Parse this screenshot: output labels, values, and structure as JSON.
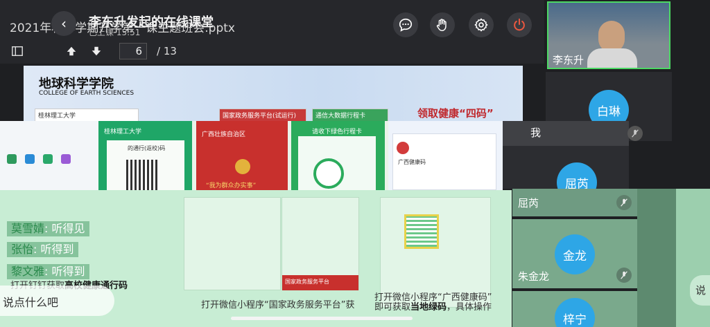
{
  "header": {
    "doc_title": "2021年秋季学期开学第一课主题班会.pptx",
    "class_title": "李东升发起的在线课堂",
    "class_status": "已上课 15:51"
  },
  "controls": [
    "chat-icon",
    "raise-hand-icon",
    "settings-icon",
    "power-icon"
  ],
  "accent_colors": {
    "power": "#e9573f",
    "speaking_border": "#4cd964",
    "avatar": "#2ea6e6"
  },
  "pager": {
    "current": "6",
    "total": "/ 13"
  },
  "slide": {
    "school_cn": "地球科学学院",
    "school_en": "COLLEGE OF EARTH SCIENCES",
    "card1": "桂林理工大学",
    "card2": "国家政务服务平台(试运行)",
    "card3": "通信大数据行程卡",
    "heading": "领取健康“四码”",
    "strip_school": "桂林理工大学",
    "strip_pass": "的通行(返校)码",
    "strip_region": "广西壮族自治区",
    "strip_slogan": "“我为群众办实事”",
    "strip_card": "请收下绿色行程卡",
    "strip_gov": "国家政务服务平台",
    "strip_health": "广西健康码"
  },
  "captions": {
    "c1_prefix": "打开钉钉获取",
    "c1_bold": "高校健康通行码",
    "c2": "打开微信小程序“国家政务服务平台”获",
    "c3_prefix": "打开微信小程序“广西健康码”",
    "c3_line2_prefix": "即可获取",
    "c3_bold": "当地绿码",
    "c3_suffix": "，具体操作"
  },
  "chat": [
    {
      "name": "莫雪婧",
      "text": ": 听得见"
    },
    {
      "name": "张怡",
      "text": ": 听得到"
    },
    {
      "name": "黎文雅",
      "text": ": 听得到"
    }
  ],
  "chat_input_placeholder": "说点什么吧",
  "participants": {
    "host": "李东升",
    "p1_avatar": "白琳",
    "p1_name": "我",
    "p2_avatar": "屈芮",
    "p2_name": "屈芮",
    "p3_avatar": "金龙",
    "p3_name": "朱金龙",
    "p4_avatar": "梓宁"
  },
  "edge_text": "说"
}
